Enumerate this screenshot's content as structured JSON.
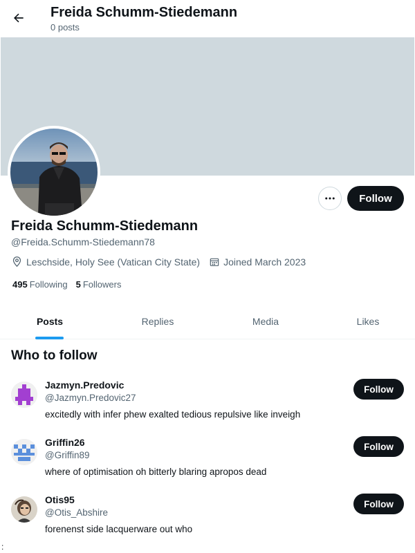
{
  "header": {
    "title": "Freida Schumm-Stiedemann",
    "subtitle": "0 posts",
    "back_icon": "arrow-left-icon"
  },
  "profile": {
    "banner_color": "#cfd9de",
    "name": "Freida Schumm-Stiedemann",
    "handle": "@Freida.Schumm-Stiedemann78",
    "location": "Leschside, Holy See (Vatican City State)",
    "joined": "Joined March 2023",
    "following_count": "495",
    "following_label": "Following",
    "followers_count": "5",
    "followers_label": "Followers",
    "follow_label": "Follow",
    "more_icon": "more-horizontal-icon"
  },
  "tabs": [
    {
      "label": "Posts",
      "active": true
    },
    {
      "label": "Replies",
      "active": false
    },
    {
      "label": "Media",
      "active": false
    },
    {
      "label": "Likes",
      "active": false
    }
  ],
  "who_to_follow": {
    "title": "Who to follow",
    "items": [
      {
        "name": "Jazmyn.Predovic",
        "handle": "@Jazmyn.Predovic27",
        "bio": "excitedly with infer phew exalted tedious repulsive like inveigh",
        "follow_label": "Follow",
        "avatar_color": "#a23fd1"
      },
      {
        "name": "Griffin26",
        "handle": "@Griffin89",
        "bio": "where of optimisation oh bitterly blaring apropos dead",
        "follow_label": "Follow",
        "avatar_color": "#5b8fdc"
      },
      {
        "name": "Otis95",
        "handle": "@Otis_Abshire",
        "bio": "forenenst side lacquerware out who",
        "follow_label": "Follow",
        "avatar_color": "#6b5a4a"
      }
    ]
  },
  "stray_char": ":",
  "colors": {
    "accent": "#1d9bf0",
    "text": "#0f1419",
    "muted": "#536471",
    "button_dark": "#0f1419"
  }
}
